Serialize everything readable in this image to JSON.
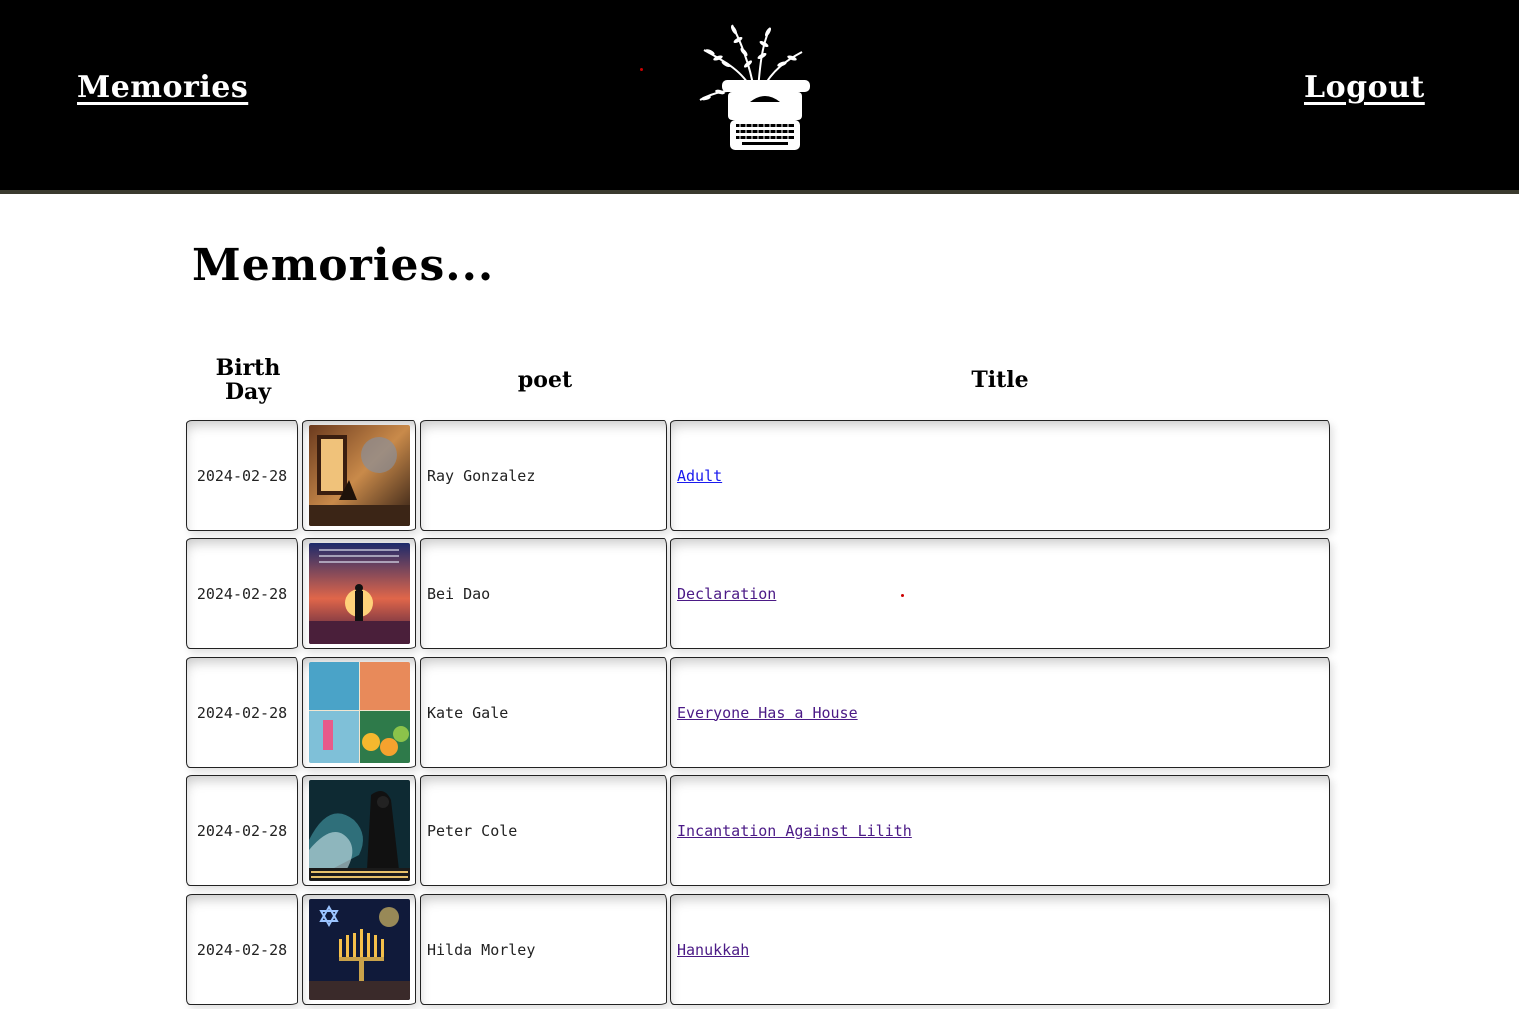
{
  "header": {
    "left_link": "Memories",
    "right_link": "Logout",
    "logo_icon": "typewriter-with-plants-logo"
  },
  "page": {
    "title": "Memories..."
  },
  "table": {
    "columns": {
      "birth_day_line1": "Birth",
      "birth_day_line2": "Day",
      "poet": "poet",
      "title": "Title"
    },
    "rows": [
      {
        "date": "2024-02-28",
        "poet": "Ray Gonzalez",
        "title": "Adult"
      },
      {
        "date": "2024-02-28",
        "poet": "Bei Dao",
        "title": "Declaration"
      },
      {
        "date": "2024-02-28",
        "poet": "Kate Gale",
        "title": "Everyone Has a House"
      },
      {
        "date": "2024-02-28",
        "poet": "Peter Cole",
        "title": "Incantation Against Lilith"
      },
      {
        "date": "2024-02-28",
        "poet": "Hilda Morley",
        "title": "Hanukkah"
      }
    ]
  },
  "colors": {
    "header_bg": "#000000",
    "link_unvisited": "#1a1aee",
    "link_visited": "#4b1a86"
  }
}
